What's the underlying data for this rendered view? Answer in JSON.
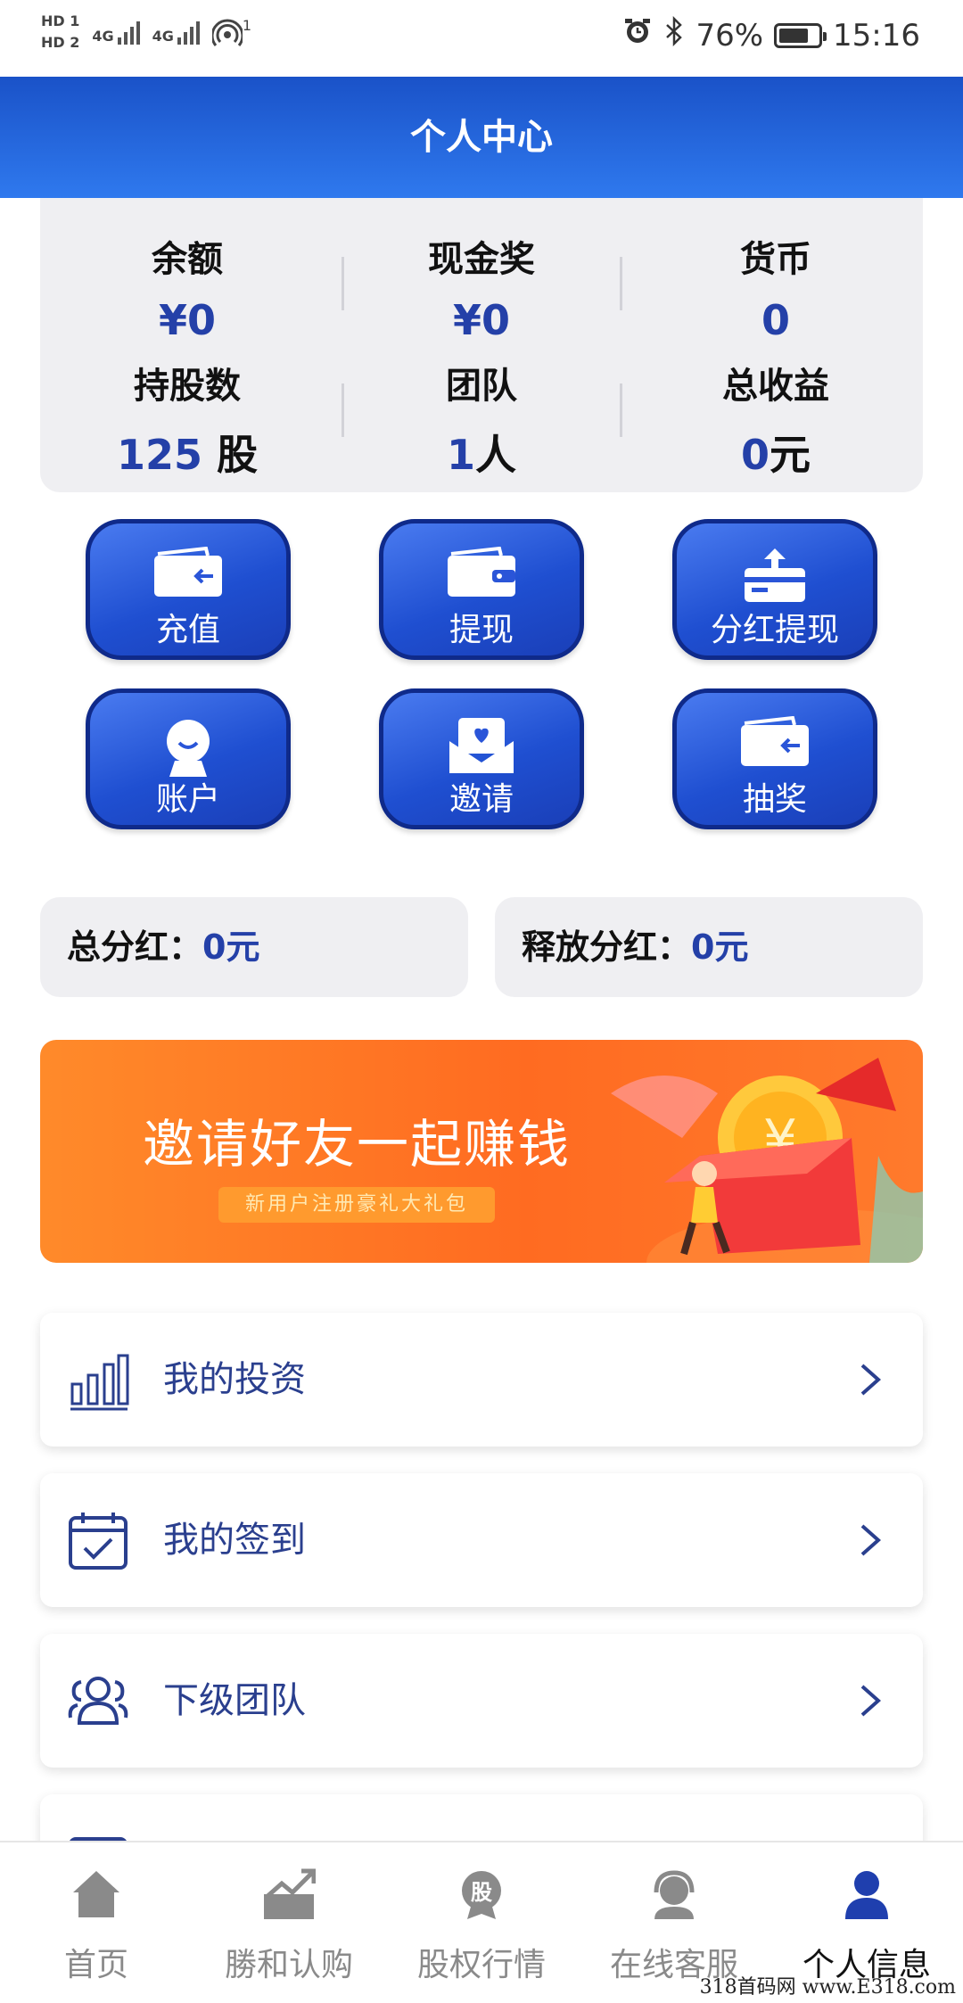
{
  "status_bar": {
    "sim1": "HD 1",
    "sim2": "HD 2",
    "net1": "4G",
    "net2": "4G",
    "hotspot_count": "1",
    "battery": "76%",
    "time": "15:16"
  },
  "header": {
    "title": "个人中心"
  },
  "stats": {
    "balance_label": "余额",
    "balance_value": "¥0",
    "cash_label": "现金奖",
    "cash_value": "¥0",
    "currency_label": "货币",
    "currency_value": "0",
    "shares_label": "持股数",
    "shares_value": "125",
    "shares_unit": " 股",
    "team_label": "团队",
    "team_value": "1",
    "team_unit": "人",
    "income_label": "总收益",
    "income_value": "0",
    "income_unit": "元"
  },
  "actions": {
    "recharge": "充值",
    "withdraw": "提现",
    "dividend_withdraw": "分红提现",
    "account": "账户",
    "invite": "邀请",
    "lottery": "抽奖"
  },
  "summary": {
    "total_dividend_label": "总分红：",
    "total_dividend_value": "0元",
    "released_dividend_label": "释放分红：",
    "released_dividend_value": "0元"
  },
  "banner": {
    "title": "邀请好友一起赚钱",
    "subtitle": "新用户注册豪礼大礼包"
  },
  "menu": {
    "investment": "我的投资",
    "checkin": "我的签到",
    "team": "下级团队"
  },
  "tabs": {
    "home": "首页",
    "subscribe": "勝和认购",
    "market": "股权行情",
    "market_icon_text": "股",
    "service": "在线客服",
    "profile": "个人信息"
  },
  "watermark": "318首码网 www.E318.com",
  "colors": {
    "accent": "#1f4fd1",
    "value_blue": "#2440a8",
    "banner_orange": "#ff6b21"
  }
}
